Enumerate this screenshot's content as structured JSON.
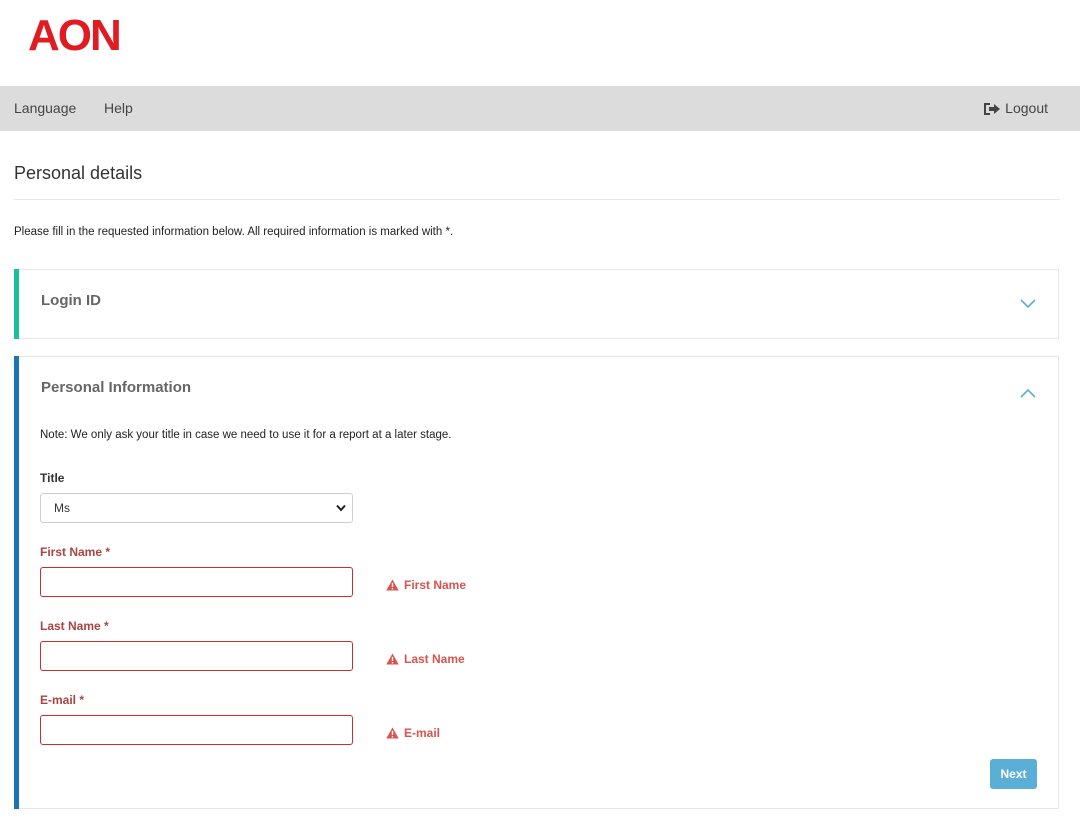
{
  "brand": {
    "logo_text": "AON",
    "color": "#e11b22"
  },
  "nav": {
    "language_label": "Language",
    "help_label": "Help",
    "logout_label": "Logout"
  },
  "page": {
    "title": "Personal details",
    "intro": "Please fill in the requested information below. All required information is marked with *."
  },
  "sections": {
    "login": {
      "title": "Login ID",
      "accent": "#1cbf9c",
      "expanded": false
    },
    "personal": {
      "title": "Personal Information",
      "accent": "#1a75b5",
      "expanded": true,
      "note": "Note: We only ask your title in case we need to use it for a report at a later stage.",
      "title_field": {
        "label": "Title",
        "value": "Ms"
      },
      "first_name": {
        "label": "First Name *",
        "value": "",
        "error": "First Name"
      },
      "last_name": {
        "label": "Last Name *",
        "value": "",
        "error": "Last Name"
      },
      "email": {
        "label": "E-mail *",
        "value": "",
        "error": "E-mail"
      },
      "next_label": "Next"
    }
  },
  "icons": {
    "logout": "sign-out-icon",
    "collapse": "chevron-down-icon",
    "expand": "chevron-up-icon",
    "error": "warning-triangle-icon",
    "select": "caret-down-icon"
  }
}
